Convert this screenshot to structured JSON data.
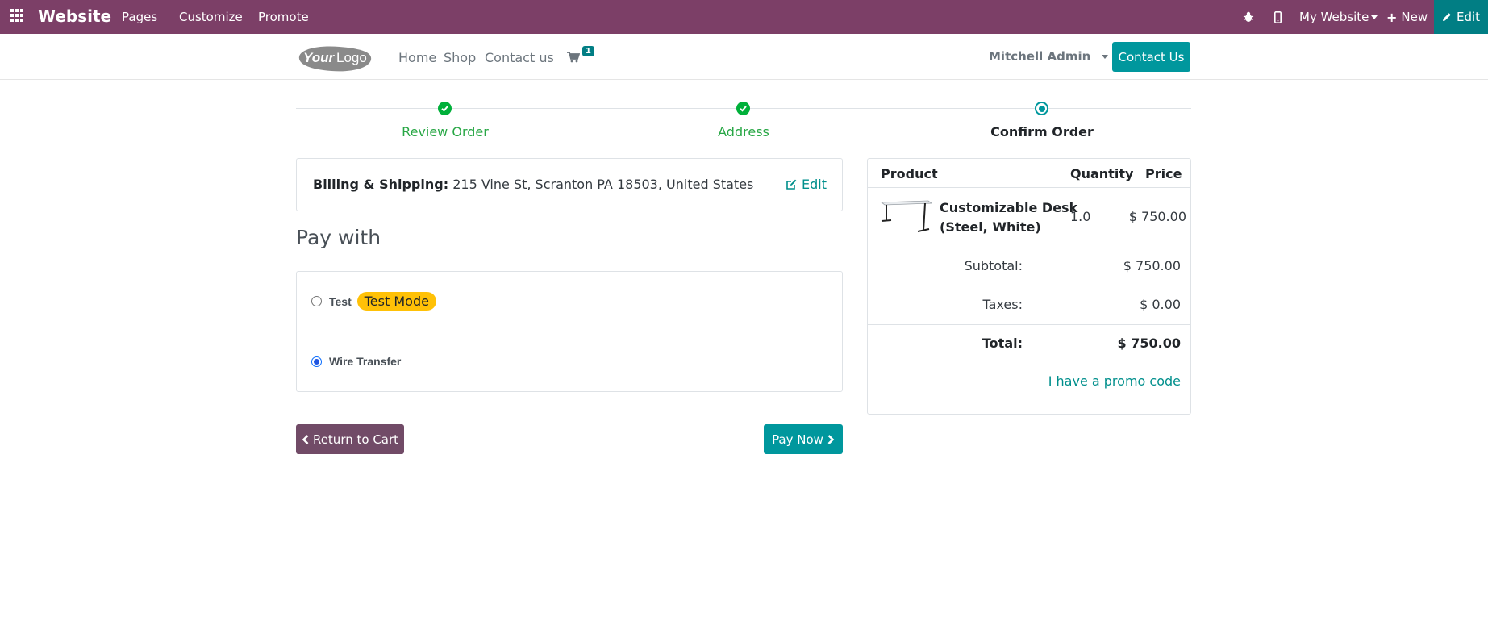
{
  "topbar": {
    "brand": "Website",
    "menus": [
      "Pages",
      "Customize",
      "Promote"
    ],
    "my_website": "My Website",
    "new_label": "New",
    "edit_label": "Edit",
    "bg_color": "#7c3f67",
    "edit_bg_color": "#017e84"
  },
  "header": {
    "logo_text": "YourLogo",
    "nav": [
      "Home",
      "Shop",
      "Contact us"
    ],
    "cart_count": "1",
    "user": "Mitchell Admin",
    "contact_button": "Contact Us",
    "accent_color": "#00979d"
  },
  "wizard": {
    "steps": [
      {
        "label": "Review Order",
        "state": "done"
      },
      {
        "label": "Address",
        "state": "done"
      },
      {
        "label": "Confirm Order",
        "state": "current"
      }
    ]
  },
  "billing": {
    "label": "Billing & Shipping:",
    "address": "215 Vine St, Scranton PA 18503, United States",
    "edit": "Edit"
  },
  "payment": {
    "heading": "Pay with",
    "methods": [
      {
        "name": "Test",
        "badge": "Test Mode",
        "selected": false
      },
      {
        "name": "Wire Transfer",
        "selected": true
      }
    ]
  },
  "actions": {
    "return": "Return to Cart",
    "pay": "Pay Now"
  },
  "summary": {
    "headers": {
      "product": "Product",
      "quantity": "Quantity",
      "price": "Price"
    },
    "items": [
      {
        "name_line1": "Customizable Desk",
        "name_line2": "(Steel, White)",
        "quantity": "1.0",
        "price": "$ 750.00"
      }
    ],
    "subtotal_label": "Subtotal:",
    "subtotal": "$ 750.00",
    "taxes_label": "Taxes:",
    "taxes": "$ 0.00",
    "total_label": "Total:",
    "total": "$ 750.00",
    "promo": "I have a promo code"
  }
}
